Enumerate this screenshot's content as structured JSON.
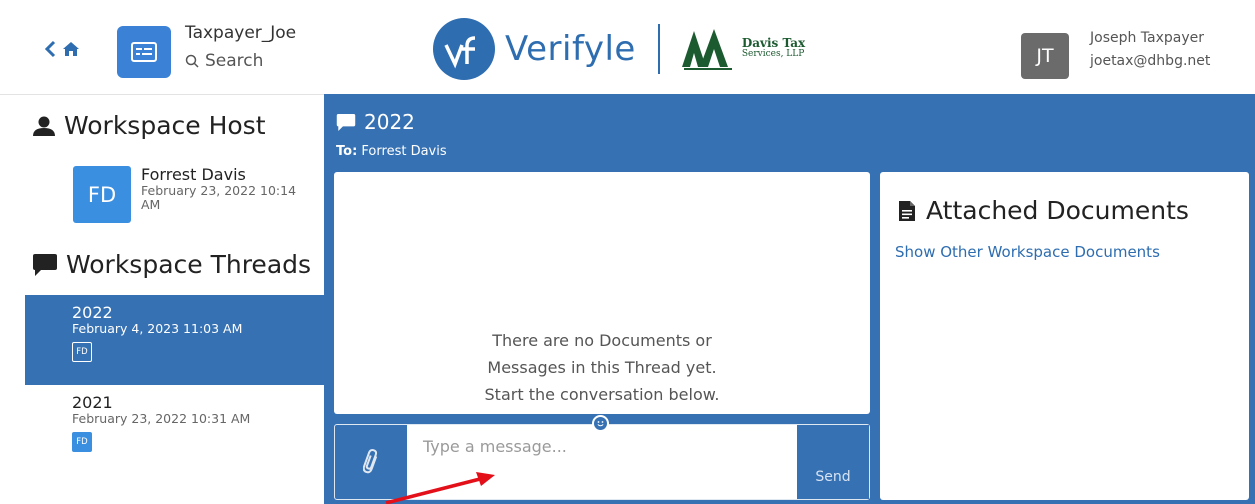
{
  "header": {
    "workspace_name": "Taxpayer_Joe",
    "search_label": "Search",
    "brand_name": "Verifyle",
    "partner_line1": "Davis Tax",
    "partner_line2": "Services, LLP",
    "user": {
      "initials": "JT",
      "name": "Joseph Taxpayer",
      "email": "joetax@dhbg.net"
    }
  },
  "sidebar": {
    "host_heading": "Workspace Host",
    "host": {
      "initials": "FD",
      "name": "Forrest Davis",
      "date": "February 23, 2022 10:14 AM"
    },
    "threads_heading": "Workspace Threads",
    "threads": [
      {
        "title": "2022",
        "date": "February 4, 2023 11:03 AM",
        "badge": "FD",
        "active": true
      },
      {
        "title": "2021",
        "date": "February 23, 2022 10:31 AM",
        "badge": "FD",
        "active": false
      }
    ]
  },
  "thread": {
    "title": "2022",
    "to_label": "To:",
    "to_name": "Forrest Davis",
    "empty_line1": "There are no Documents or",
    "empty_line2": "Messages in this Thread yet.",
    "empty_line3": "Start the conversation below."
  },
  "composer": {
    "placeholder": "Type a message...",
    "send_label": "Send"
  },
  "documents": {
    "heading": "Attached Documents",
    "link_label": "Show Other Workspace Documents"
  },
  "icons": [
    "back-chevron-icon",
    "home-icon",
    "workspace-card-icon",
    "search-icon",
    "user-icon",
    "chat-bubble-icon",
    "paperclip-icon",
    "emoji-icon",
    "document-icon"
  ],
  "colors": {
    "primary": "#3671b3",
    "avatar_blue": "#3b8fe0",
    "brand_blue": "#2e6db0",
    "partner_green": "#1c5a30",
    "user_avatar": "#6b6b6b",
    "annotation_red": "#e3101a"
  }
}
